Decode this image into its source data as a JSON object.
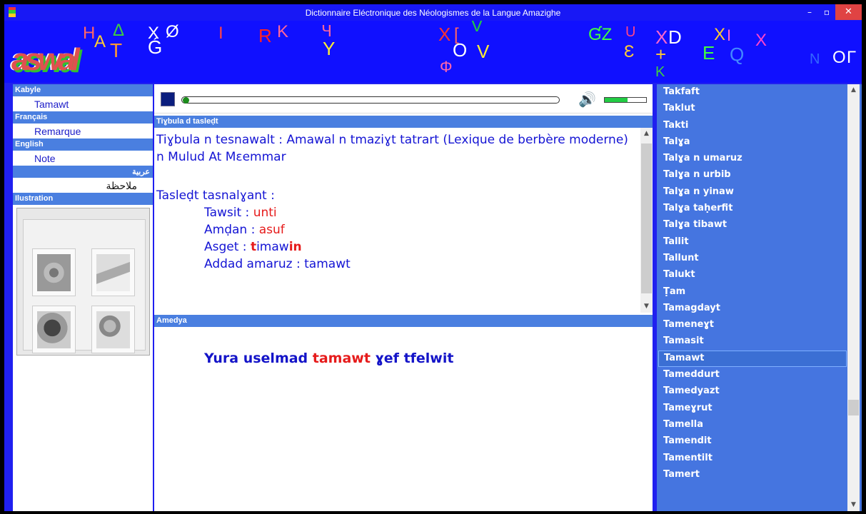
{
  "window": {
    "title": "Dictionnaire Eléctronique des Néologismes de la Langue Amazighe",
    "minimize": "–",
    "maximize": "▫",
    "close": "✕"
  },
  "banner": {
    "logo": "aswal",
    "glyphs": [
      "H",
      "Δ",
      "A",
      "T",
      "X",
      "Ø",
      "Ǵ",
      "I",
      "R",
      "K",
      "Ɥ",
      "Y",
      "X",
      "[",
      "V",
      "O",
      "V",
      "Φ",
      "ƓZ",
      "U",
      "Ɛ",
      "X",
      "D",
      "+",
      "K",
      "X",
      "I",
      "E",
      "Q",
      "X",
      "N",
      "O",
      "Г"
    ]
  },
  "sidebar": {
    "sections": [
      {
        "header": "Kabyle",
        "item": "Tamawt"
      },
      {
        "header": "Français",
        "item": "Remarque"
      },
      {
        "header": "English",
        "item": "Note"
      },
      {
        "header": "عربية",
        "item": "ملاحظة"
      }
    ],
    "illustration_header": "Ilustration"
  },
  "player": {
    "progress": 0.0,
    "volume": 0.55,
    "volume_icon": "speaker-icon"
  },
  "definition": {
    "header": "Tiɣbula d tasleḍt",
    "line1": "Tiɣbula n tesnawalt : Amawal n tmaziɣt tatrart (Lexique de berbère moderne)",
    "line2": "n Mulud At Mɛemmar",
    "line3": "Tasleḍt tasnalɣant :",
    "tawsit_label": "Tawsit : ",
    "tawsit_value": "unti",
    "amdan_label": "Amḍan : ",
    "amdan_value": "asuf",
    "asget_label": "Asget  : ",
    "asget_t": "t",
    "asget_mid": "imaw",
    "asget_end": "in",
    "addad_label": "Addad amaruz : tamawt"
  },
  "example": {
    "header": "Amedya",
    "part1": "Yura uselmad ",
    "highlight": "tamawt",
    "part2": " ɣef tfelwit"
  },
  "wordlist": {
    "selected": "Tamawt",
    "items": [
      "Takfaft",
      "Taklut",
      "Takti",
      "Talɣa",
      "Talɣa n umaruz",
      "Talɣa n urbib",
      "Talɣa n yinaw",
      "Talɣa taḥerfit",
      "Talɣa tibawt",
      "Tallit",
      "Tallunt",
      "Talukt",
      "Ṭam",
      "Tamagdayt",
      "Tameneɣt",
      "Tamasit",
      "Tamawt",
      "Tameddurt",
      "Tamedyazt",
      "Tameɣrut",
      "Tamella",
      "Tamendit",
      "Tamentilt",
      "Tamert"
    ]
  },
  "colors": {
    "window_bg": "#2020f0",
    "section_header": "#4a7fe0",
    "word_list_bg": "#4575e0",
    "text_blue": "#1414d4",
    "highlight_red": "#e61b1b",
    "close_button": "#e04343"
  }
}
